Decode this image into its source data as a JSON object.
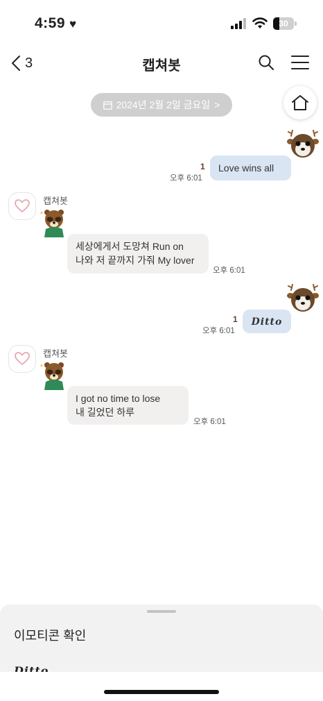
{
  "status_bar": {
    "time": "4:59",
    "battery": "30",
    "battery_level": 0.3
  },
  "nav": {
    "back_count": "3",
    "title": "캡쳐봇"
  },
  "date_pill": {
    "label": "2024년 2월 2일 금요일",
    "chevron": ">"
  },
  "messages": [
    {
      "direction": "out",
      "text": "Love wins all",
      "time": "오후 6:01",
      "unread": "1"
    },
    {
      "direction": "in",
      "sender": "캡쳐봇",
      "lines": [
        "세상에게서 도망쳐 Run on",
        "나와 저 끝까지 가줘 My lover"
      ],
      "time": "오후 6:01"
    },
    {
      "direction": "out",
      "emoticon": "Ditto",
      "time": "오후 6:01",
      "unread": "1"
    },
    {
      "direction": "in",
      "sender": "캡쳐봇",
      "lines": [
        "I got no time to lose",
        "내 길었던 하루"
      ],
      "time": "오후 6:01"
    }
  ],
  "sheet": {
    "title": "이모티콘 확인",
    "preview": "Ditto"
  },
  "colors": {
    "out_bubble": "#d9e5f3",
    "in_bubble": "#f2f0ef",
    "date_pill": "#cfcfcf",
    "unread": "#6b3c2a"
  },
  "icons": [
    "heart-icon",
    "signal-icon",
    "wifi-icon",
    "back-chevron-icon",
    "search-icon",
    "menu-icon",
    "calendar-icon",
    "home-icon",
    "profile-heart-icon",
    "deer-sticker-icon",
    "tanuki-sticker-icon"
  ]
}
